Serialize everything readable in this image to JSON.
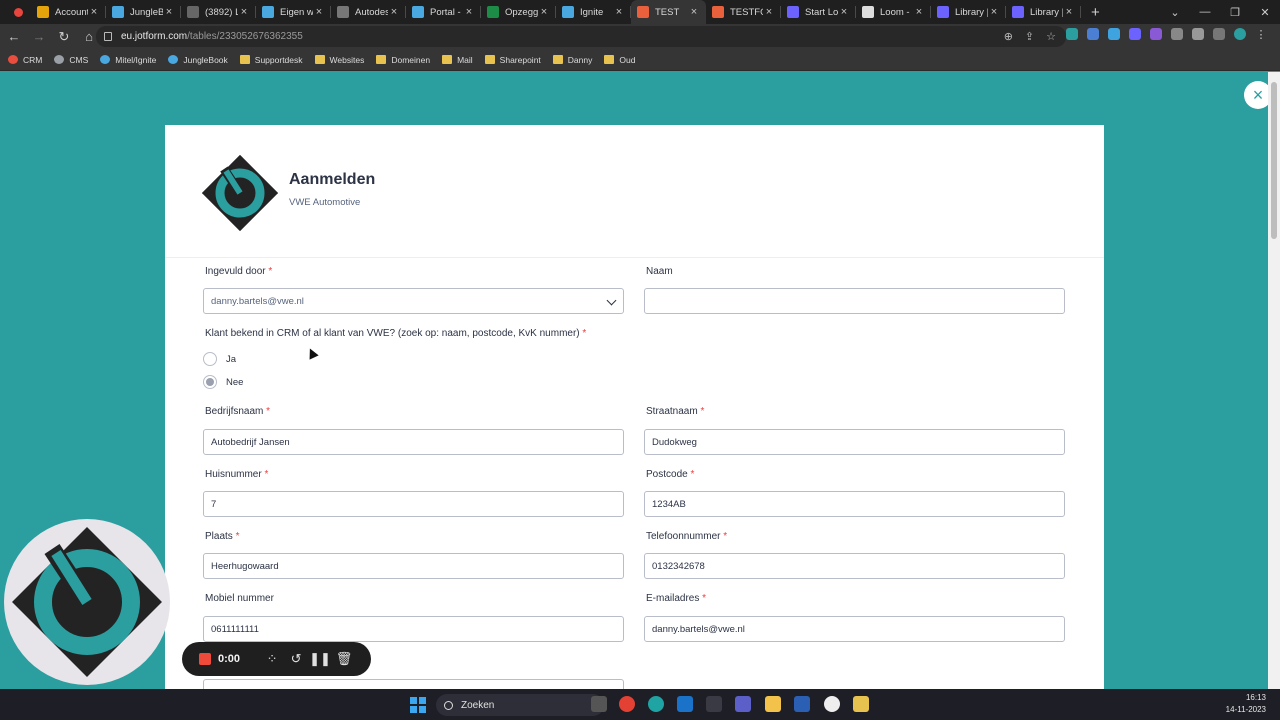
{
  "browser": {
    "tabs": [
      {
        "label": "Account",
        "fav_color": "#e5a50a",
        "active": false
      },
      {
        "label": "JungleBo",
        "fav_color": "#4aa8e0",
        "active": false
      },
      {
        "label": "(3892) L",
        "fav_color": "#666666",
        "active": false
      },
      {
        "label": "Eigen wi",
        "fav_color": "#4aa8e0",
        "active": false
      },
      {
        "label": "Autodes",
        "fav_color": "#777777",
        "active": false
      },
      {
        "label": "Portal - I",
        "fav_color": "#4aa8e0",
        "active": false
      },
      {
        "label": "Opzeggi",
        "fav_color": "#1d8c46",
        "active": false
      },
      {
        "label": "Ignite",
        "fav_color": "#4aa8e0",
        "active": false
      },
      {
        "label": "TEST",
        "fav_color": "#e8603c",
        "active": true
      },
      {
        "label": "TESTFOR",
        "fav_color": "#e8603c",
        "active": false
      },
      {
        "label": "Start Loc",
        "fav_color": "#6c63ff",
        "active": false
      },
      {
        "label": "Loom -",
        "fav_color": "#dddddd",
        "active": false
      },
      {
        "label": "Library |",
        "fav_color": "#6c63ff",
        "active": false
      },
      {
        "label": "Library |",
        "fav_color": "#6c63ff",
        "active": false
      }
    ],
    "new_tab_label": "+",
    "url_host": "eu.jotform.com",
    "url_path": "/tables/233052676362355",
    "bookmarks": [
      {
        "label": "CRM",
        "kind": "app",
        "color": "#e84d3d"
      },
      {
        "label": "CMS",
        "kind": "app",
        "color": "#9aa0a6"
      },
      {
        "label": "Mitel/Ignite",
        "kind": "app",
        "color": "#4aa8e0"
      },
      {
        "label": "JungleBook",
        "kind": "app",
        "color": "#4aa8e0"
      },
      {
        "label": "Supportdesk",
        "kind": "folder",
        "color": "#e8c24f"
      },
      {
        "label": "Websites",
        "kind": "folder",
        "color": "#e8c24f"
      },
      {
        "label": "Domeinen",
        "kind": "folder",
        "color": "#e8c24f"
      },
      {
        "label": "Mail",
        "kind": "folder",
        "color": "#e8c24f"
      },
      {
        "label": "Sharepoint",
        "kind": "folder",
        "color": "#e8c24f"
      },
      {
        "label": "Danny",
        "kind": "folder",
        "color": "#e8c24f"
      },
      {
        "label": "Oud",
        "kind": "folder",
        "color": "#e8c24f"
      }
    ]
  },
  "form": {
    "title": "Aanmelden",
    "subtitle": "VWE Automotive",
    "close_icon": "×",
    "accent_color": "#2b9ea0",
    "fields": {
      "ingevuld_door": {
        "label": "Ingevuld door",
        "required": "*",
        "value": "danny.bartels@vwe.nl"
      },
      "naam": {
        "label": "Naam",
        "value": ""
      },
      "klant_bekend": {
        "label": "Klant bekend in CRM of al klant van VWE? (zoek op: naam, postcode, KvK nummer)",
        "required": "*",
        "options": [
          "Ja",
          "Nee"
        ],
        "selected": "Nee"
      },
      "bedrijfsnaam": {
        "label": "Bedrijfsnaam",
        "required": "*",
        "value": "Autobedrijf Jansen"
      },
      "straatnaam": {
        "label": "Straatnaam",
        "required": "*",
        "value": "Dudokweg"
      },
      "huisnummer": {
        "label": "Huisnummer",
        "required": "*",
        "value": "7"
      },
      "postcode": {
        "label": "Postcode",
        "required": "*",
        "value": "1234AB"
      },
      "plaats": {
        "label": "Plaats",
        "required": "*",
        "value": "Heerhugowaard"
      },
      "telefoonnummer": {
        "label": "Telefoonnummer",
        "required": "*",
        "value": "0132342678"
      },
      "mobiel_nummer": {
        "label": "Mobiel nummer",
        "value": "0611111111"
      },
      "emailadres": {
        "label": "E-mailadres",
        "required": "*",
        "value": "danny.bartels@vwe.nl"
      }
    }
  },
  "recorder": {
    "time": "0:00",
    "stop_color": "#f04a3a"
  },
  "taskbar": {
    "search_label": "Zoeken",
    "time": "16:13",
    "date": "14-11-2023"
  }
}
